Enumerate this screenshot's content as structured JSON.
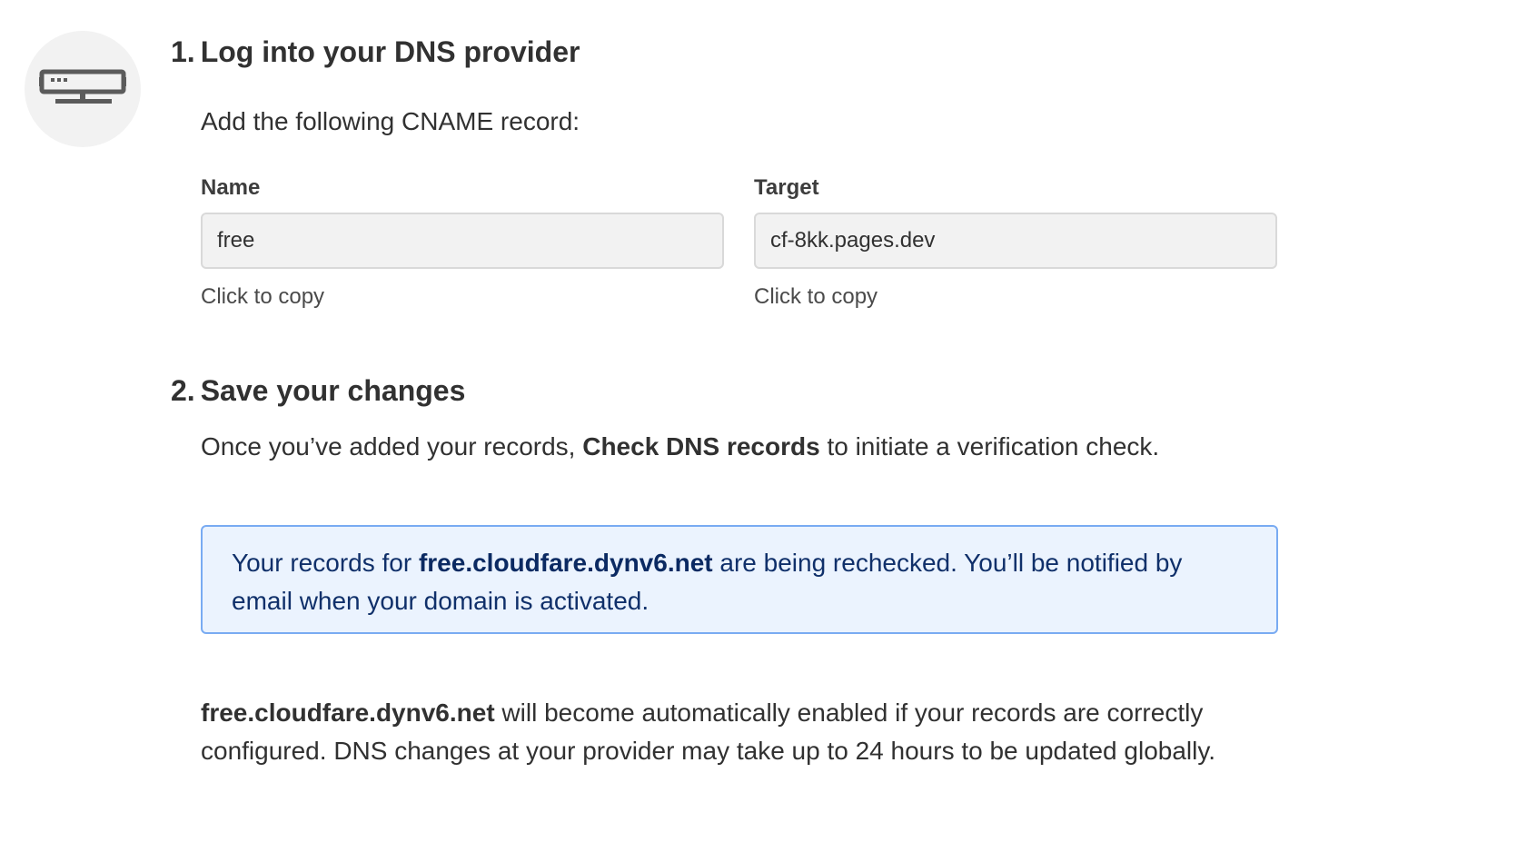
{
  "step1": {
    "number": "1.",
    "title": "Log into your DNS provider",
    "intro": "Add the following CNAME record:",
    "name_label": "Name",
    "name_value": "free",
    "target_label": "Target",
    "target_value": "cf-8kk.pages.dev",
    "copy_hint": "Click to copy"
  },
  "step2": {
    "number": "2.",
    "title": "Save your changes",
    "desc_before": "Once you’ve added your records, ",
    "desc_bold": "Check DNS records",
    "desc_after": " to initiate a verification check."
  },
  "notice": {
    "before": "Your records for ",
    "domain": "free.cloudfare.dynv6.net",
    "after": " are being rechecked. You’ll be notified by email when your domain is activated.",
    "colors": {
      "background": "#ebf3fe",
      "border": "#79abf2",
      "text": "#10306a"
    }
  },
  "footer": {
    "domain": "free.cloudfare.dynv6.net",
    "text": " will become automatically enabled if your records are correctly configured. DNS changes at your provider may take up to 24 hours to be updated globally."
  },
  "icons": {
    "step_icon": "dns-server-icon"
  }
}
